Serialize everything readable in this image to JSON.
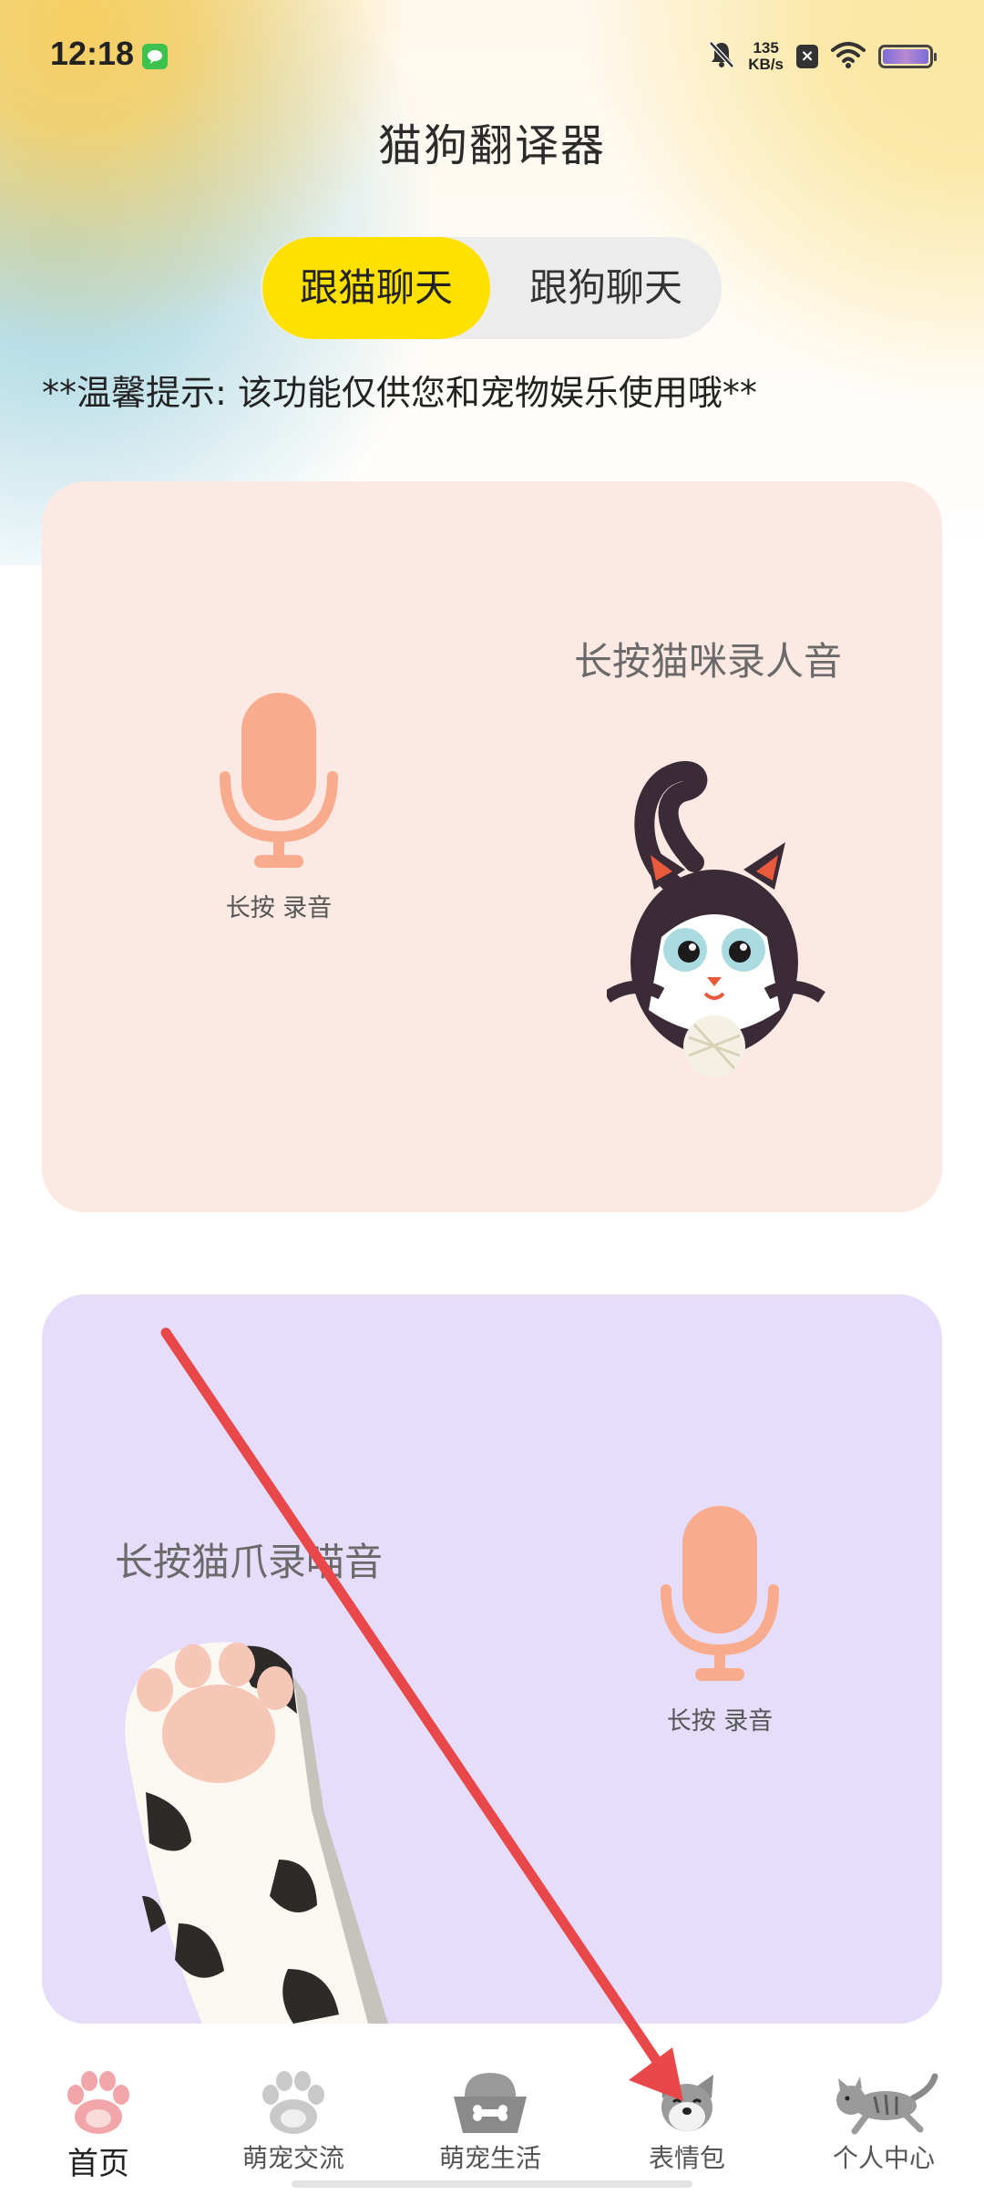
{
  "status_bar": {
    "time": "12:18",
    "net_speed_value": "135",
    "net_speed_unit": "KB/s",
    "icons": [
      "wechat-icon",
      "bell-mute-icon",
      "close-square-icon",
      "wifi-icon",
      "battery-icon"
    ]
  },
  "header": {
    "title": "猫狗翻译器"
  },
  "tabs": [
    {
      "label": "跟猫聊天",
      "selected": true
    },
    {
      "label": "跟狗聊天",
      "selected": false
    }
  ],
  "tip": "**温馨提示: 该功能仅供您和宠物娱乐使用哦**",
  "cards": [
    {
      "title": "长按猫咪录人音",
      "mic_caption": "长按 录音"
    },
    {
      "title": "长按猫爪录喵音",
      "mic_caption": "长按 录音"
    }
  ],
  "bottom_nav": [
    {
      "label": "首页",
      "active": true
    },
    {
      "label": "萌宠交流",
      "active": false
    },
    {
      "label": "萌宠生活",
      "active": false
    },
    {
      "label": "表情包",
      "active": false
    },
    {
      "label": "个人中心",
      "active": false
    }
  ],
  "colors": {
    "accent_yellow": "#ffe100",
    "card_cat_bg": "#fce9e3",
    "card_paw_bg": "#e5ddfa",
    "mic_color": "#f9ab8d",
    "annotation_arrow": "#e8484a"
  }
}
